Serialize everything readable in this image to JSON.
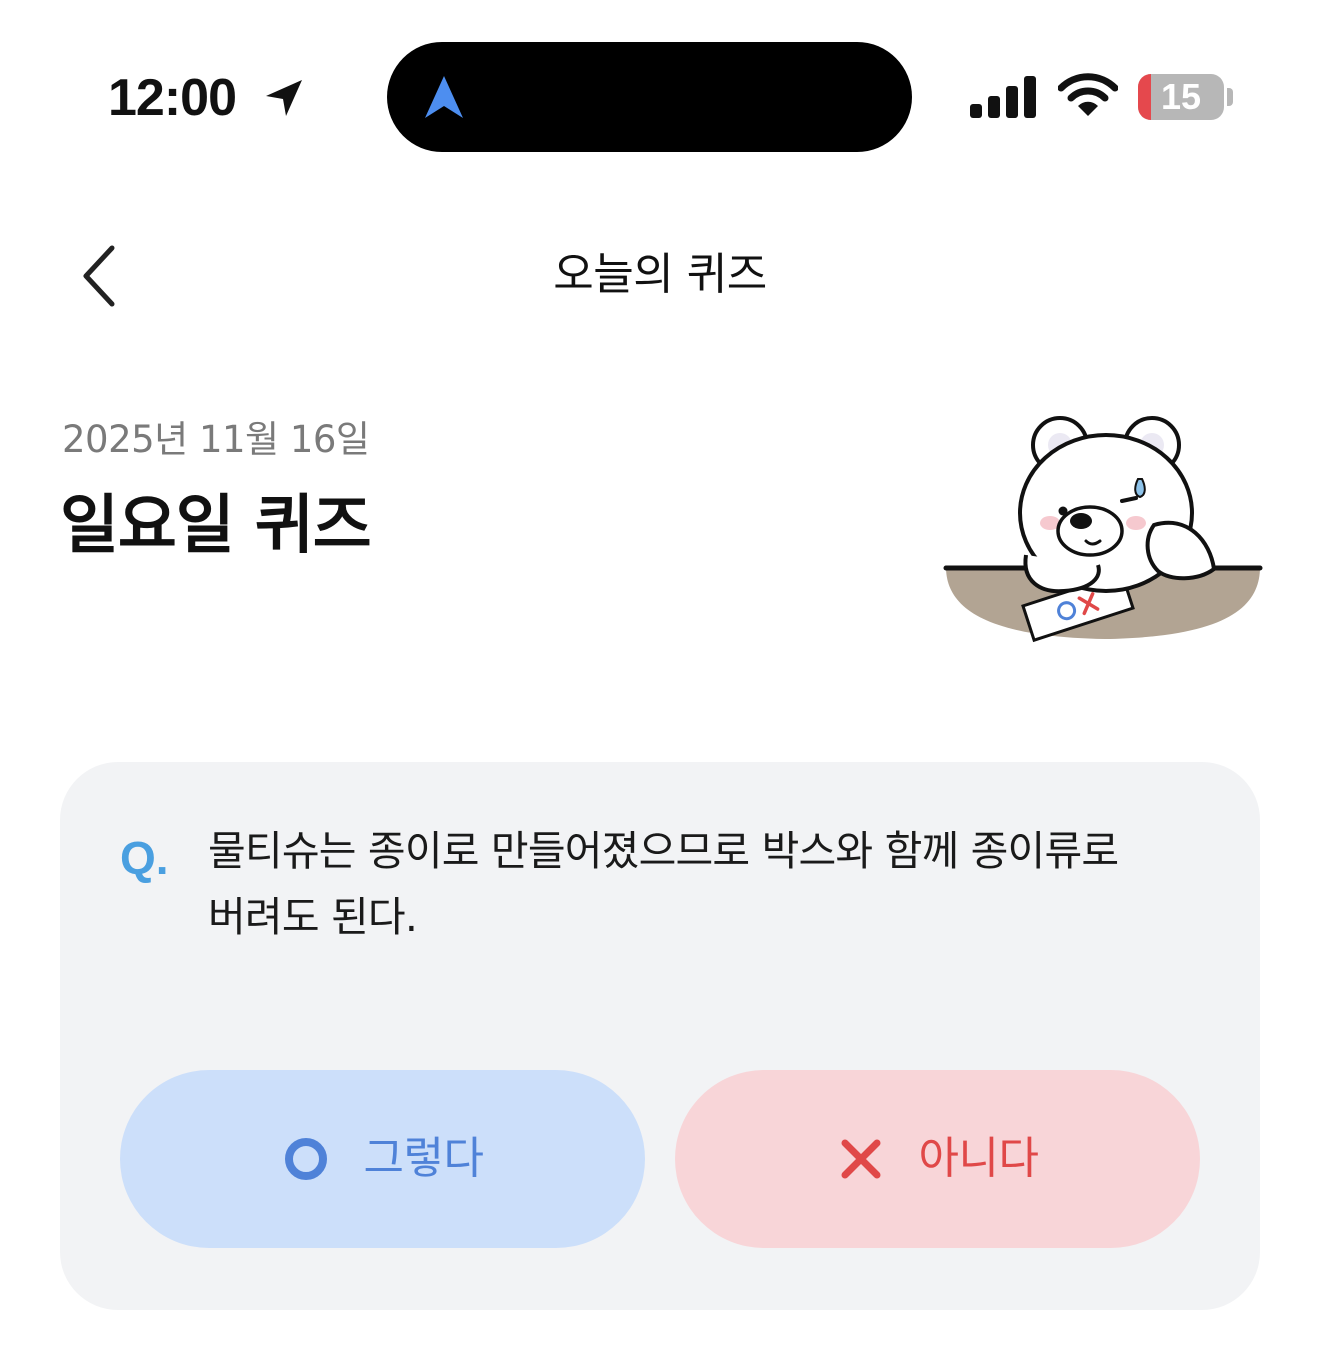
{
  "status_bar": {
    "time": "12:00",
    "battery_level": "15",
    "battery_fraction": 0.15,
    "icons": [
      "location-arrow-icon",
      "navigation-icon",
      "cellular-signal-icon",
      "wifi-icon",
      "battery-icon"
    ]
  },
  "header": {
    "title": "오늘의 퀴즈",
    "back_icon": "chevron-left-icon"
  },
  "quiz": {
    "date": "2025년 11월 16일",
    "title": "일요일 퀴즈",
    "illustration": "bear-at-desk-illustration",
    "question_marker": "Q.",
    "question": "물티슈는 종이로 만들어졌으므로 박스와 함께 종이류로 버려도 된다.",
    "answers": [
      {
        "label": "그렇다",
        "icon": "circle-o-icon"
      },
      {
        "label": "아니다",
        "icon": "x-mark-icon"
      }
    ]
  },
  "colors": {
    "accent_blue": "#4f82d8",
    "accent_red": "#e04848",
    "yes_bg": "#ccdffa",
    "no_bg": "#f8d5d8",
    "card_bg": "#f2f3f5",
    "question_marker": "#4a9fe0"
  }
}
